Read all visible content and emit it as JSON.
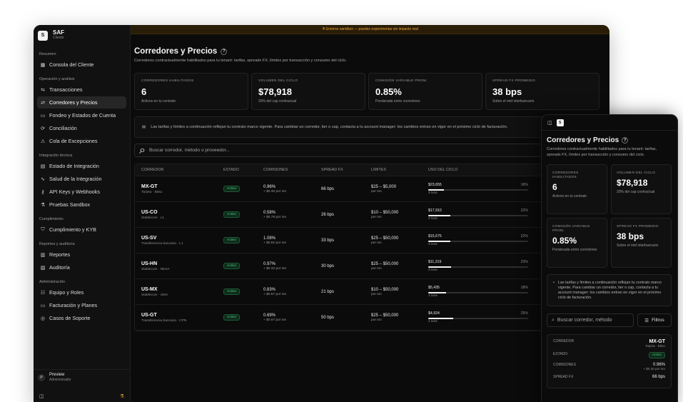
{
  "sidebar": {
    "brand": {
      "logo_letter": "S",
      "name": "SAF",
      "sub": "Cliente"
    },
    "sections": [
      {
        "label": "Resumen",
        "items": [
          {
            "icon": "grid-icon",
            "glyph": "▦",
            "label": "Consola del Cliente"
          }
        ]
      },
      {
        "label": "Operación y análisis",
        "items": [
          {
            "icon": "arrows-icon",
            "glyph": "⇆",
            "label": "Transacciones"
          },
          {
            "icon": "routes-icon",
            "glyph": "⇄",
            "label": "Corredores y Precios",
            "active": true
          },
          {
            "icon": "wallet-icon",
            "glyph": "▭",
            "label": "Fondeo y Estados de Cuenta"
          },
          {
            "icon": "reconcile-icon",
            "glyph": "⟳",
            "label": "Conciliación"
          },
          {
            "icon": "warning-icon",
            "glyph": "⚠",
            "label": "Cola de Excepciones"
          }
        ]
      },
      {
        "label": "Integración técnica",
        "items": [
          {
            "icon": "clipboard-icon",
            "glyph": "▤",
            "label": "Estado de Integración"
          },
          {
            "icon": "pulse-icon",
            "glyph": "∿",
            "label": "Salud de la Integración"
          },
          {
            "icon": "key-icon",
            "glyph": "⚷",
            "label": "API Keys y Webhooks"
          },
          {
            "icon": "flask-icon",
            "glyph": "⚗",
            "label": "Pruebas Sandbox"
          }
        ]
      },
      {
        "label": "Cumplimiento",
        "items": [
          {
            "icon": "shield-icon",
            "glyph": "⛉",
            "label": "Cumplimiento y KYB"
          }
        ]
      },
      {
        "label": "Reportes y auditoría",
        "items": [
          {
            "icon": "report-icon",
            "glyph": "▥",
            "label": "Reportes"
          },
          {
            "icon": "audit-icon",
            "glyph": "▧",
            "label": "Auditoría"
          }
        ]
      },
      {
        "label": "Administración",
        "items": [
          {
            "icon": "users-icon",
            "glyph": "☷",
            "label": "Equipo y Roles"
          },
          {
            "icon": "card-icon",
            "glyph": "▭",
            "label": "Facturación y Planes"
          },
          {
            "icon": "support-icon",
            "glyph": "◎",
            "label": "Casos de Soporte"
          }
        ]
      }
    ],
    "footer": {
      "avatar": "P",
      "name": "Preview",
      "role": "Administrador"
    }
  },
  "banner": {
    "text": "⚗ Entorno sandbox — puedes experimentar sin impacto real"
  },
  "page": {
    "title": "Corredores y Precios",
    "help": "?",
    "subtitle": "Corredores contractualmente habilitados para tu tenant: tarifas, spreads FX, límites por transacción y consumo del ciclo."
  },
  "kpis": [
    {
      "label": "CORREDORES HABILITADOS",
      "value": "6",
      "sub": "Activos en tu contrato"
    },
    {
      "label": "VOLUMEN DEL CICLO",
      "value": "$78,918",
      "sub": "20% del cap contractual"
    },
    {
      "label": "COMISIÓN VARIABLE PROM.",
      "value": "0.85%",
      "sub": "Ponderada entre corredores"
    },
    {
      "label": "SPREAD FX PROMEDIO",
      "value": "38 bps",
      "sub": "Sobre el mid interbancario"
    }
  ],
  "info": {
    "text": "Las tarifas y límites a continuación reflejan tu contrato marco vigente. Para cambiar un corredor, tier o cap, contacta a tu account manager: los cambios entran en vigor en el próximo ciclo de facturación."
  },
  "search": {
    "placeholder": "Buscar corredor, método o proveedor..."
  },
  "table": {
    "headers": [
      "CORREDOR",
      "ESTADO",
      "COMISIONES",
      "SPREAD FX",
      "LÍMITES",
      "USO DEL CICLO"
    ],
    "rows": [
      {
        "name": "MX-GT",
        "method": "Tarjeta · Bitso",
        "status": "Activo",
        "fee": "0.96%",
        "fee_fixed": "+ $0.30 por txn",
        "spread": "66 bps",
        "limit": "$25 – $5,000",
        "limit_unit": "por txn",
        "usage": "$23,655",
        "pct": "16%",
        "pct_value": 16,
        "txns": "3 txns"
      },
      {
        "name": "US-CO",
        "method": "Stablecoin · L1",
        "status": "Activo",
        "fee": "0.58%",
        "fee_fixed": "+ $0.78 por txn",
        "spread": "26 bps",
        "limit": "$10 – $50,000",
        "limit_unit": "por txn",
        "usage": "$17,910",
        "pct": "22%",
        "pct_value": 22,
        "txns": "2 txns"
      },
      {
        "name": "US-SV",
        "method": "Transferencia bancaria · L1",
        "status": "Activo",
        "fee": "1.08%",
        "fee_fixed": "+ $0.82 por txn",
        "spread": "33 bps",
        "limit": "$25 – $50,000",
        "limit_unit": "por txn",
        "usage": "$15,675",
        "pct": "22%",
        "pct_value": 22,
        "txns": "3 txns"
      },
      {
        "name": "US-HN",
        "method": "Stablecoin · NEXA",
        "status": "Activo",
        "fee": "0.97%",
        "fee_fixed": "+ $0.32 por txn",
        "spread": "30 bps",
        "limit": "$25 – $50,000",
        "limit_unit": "por txn",
        "usage": "$11,319",
        "pct": "23%",
        "pct_value": 23,
        "txns": "2 txns"
      },
      {
        "name": "US-MX",
        "method": "Stablecoin · UMA",
        "status": "Activo",
        "fee": "0.83%",
        "fee_fixed": "+ $0.57 por txn",
        "spread": "21 bps",
        "limit": "$10 – $50,000",
        "limit_unit": "por txn",
        "usage": "$5,435",
        "pct": "18%",
        "pct_value": 18,
        "txns": "1 txns"
      },
      {
        "name": "US-GT",
        "method": "Transferencia bancaria · CPN",
        "status": "Activo",
        "fee": "0.69%",
        "fee_fixed": "+ $0.67 por txn",
        "spread": "50 bps",
        "limit": "$25 – $50,000",
        "limit_unit": "por txn",
        "usage": "$4,924",
        "pct": "25%",
        "pct_value": 25,
        "txns": "1 txns"
      }
    ]
  },
  "mobile": {
    "logo_letter": "S",
    "title": "Corredores y Precios",
    "subtitle": "Corredores contractualmente habilitados para tu tenant: tarifas, spreads FX, límites por transacción y consumo del ciclo.",
    "info": "Las tarifas y límites a continuación reflejan tu contrato marco vigente. Para cambiar un corredor, tier o cap, contacta a tu account manager: los cambios entran en vigor en el próximo ciclo de facturación.",
    "search_placeholder": "Buscar corredor, método",
    "filter_label": "Filtros",
    "card": {
      "corridor_label": "CORREDOR",
      "corridor_value": "MX-GT",
      "corridor_sub": "Tarjeta · Bitso",
      "status_label": "ESTADO",
      "status_value": "Activo",
      "fee_label": "COMISIONES",
      "fee_value": "0.96%",
      "fee_sub": "+ $0.30 por txn",
      "spread_label": "SPREAD FX",
      "spread_value": "66 bps"
    }
  }
}
